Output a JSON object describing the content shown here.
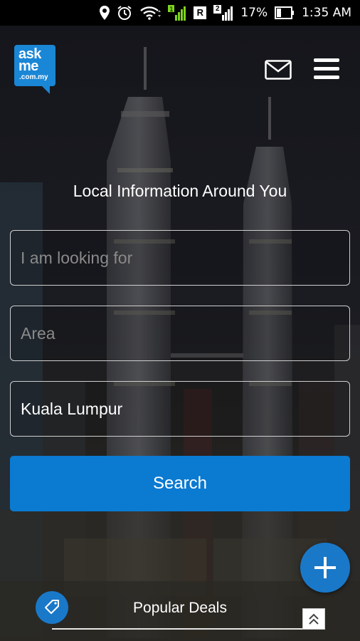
{
  "status_bar": {
    "network_r": "R",
    "network_2": "2",
    "battery": "17%",
    "time": "1:35 AM",
    "icons": [
      "location-icon",
      "alarm-icon",
      "wifi-icon",
      "signal-1-icon",
      "signal-2-icon",
      "battery-icon"
    ]
  },
  "header": {
    "logo": {
      "line1": "ask",
      "line2": "me",
      "line3": ".com.my"
    },
    "icons": [
      "mail-icon",
      "menu-icon"
    ]
  },
  "main": {
    "headline": "Local Information Around You",
    "looking_for_placeholder": "I am looking for",
    "area_placeholder": "Area",
    "city_value": "Kuala Lumpur",
    "search_label": "Search"
  },
  "fab": {
    "icon": "plus-icon"
  },
  "deals": {
    "label": "Popular Deals",
    "icons": [
      "tag-icon",
      "double-chevron-up-icon"
    ]
  },
  "colors": {
    "brand_blue": "#1a86d6",
    "button_blue": "#0b7ad1",
    "fab_blue": "#1a78c8"
  }
}
